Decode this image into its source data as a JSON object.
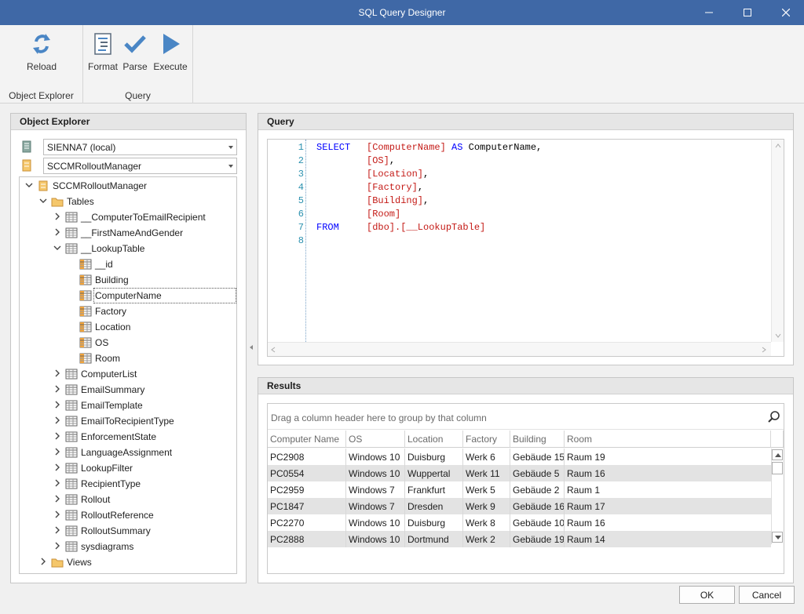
{
  "window": {
    "title": "SQL Query Designer"
  },
  "ribbon": {
    "groups": [
      {
        "label": "Object Explorer",
        "buttons": [
          {
            "label": "Reload",
            "icon": "reload-icon"
          }
        ]
      },
      {
        "label": "Query",
        "buttons": [
          {
            "label": "Format",
            "icon": "format-icon"
          },
          {
            "label": "Parse",
            "icon": "checkmark-icon"
          },
          {
            "label": "Execute",
            "icon": "play-icon"
          }
        ]
      }
    ]
  },
  "object_explorer": {
    "title": "Object Explorer",
    "server": "SIENNA7 (local)",
    "database": "SCCMRolloutManager",
    "tree": {
      "root": "SCCMRolloutManager",
      "tables_label": "Tables",
      "tables_before": [
        "__ComputerToEmailRecipient",
        "__FirstNameAndGender"
      ],
      "expanded_table": "__LookupTable",
      "columns": [
        "__id",
        "Building",
        "ComputerName",
        "Factory",
        "Location",
        "OS",
        "Room"
      ],
      "selected_column": "ComputerName",
      "tables_after": [
        "ComputerList",
        "EmailSummary",
        "EmailTemplate",
        "EmailToRecipientType",
        "EnforcementState",
        "LanguageAssignment",
        "LookupFilter",
        "RecipientType",
        "Rollout",
        "RolloutReference",
        "RolloutSummary",
        "sysdiagrams"
      ],
      "views_label": "Views"
    }
  },
  "query": {
    "title": "Query",
    "lines": [
      {
        "n": "1",
        "kw": "SELECT",
        "id": "[ComputerName]",
        "rest": " AS ComputerName,",
        "rest_kw": "AS",
        "rest_tail": " ComputerName,"
      },
      {
        "n": "2",
        "kw": "",
        "id": "[OS]",
        "tail": ","
      },
      {
        "n": "3",
        "kw": "",
        "id": "[Location]",
        "tail": ","
      },
      {
        "n": "4",
        "kw": "",
        "id": "[Factory]",
        "tail": ","
      },
      {
        "n": "5",
        "kw": "",
        "id": "[Building]",
        "tail": ","
      },
      {
        "n": "6",
        "kw": "",
        "id": "[Room]",
        "tail": ""
      },
      {
        "n": "7",
        "kw": "FROM",
        "id": "[dbo].[__LookupTable]",
        "tail": ""
      },
      {
        "n": "8",
        "kw": "",
        "id": "",
        "tail": ""
      }
    ]
  },
  "results": {
    "title": "Results",
    "group_hint": "Drag a column header here to group by that column",
    "columns": [
      "Computer Name",
      "OS",
      "Location",
      "Factory",
      "Building",
      "Room"
    ],
    "rows": [
      [
        "PC2908",
        "Windows 10",
        "Duisburg",
        "Werk 6",
        "Gebäude 15",
        "Raum 19"
      ],
      [
        "PC0554",
        "Windows 10",
        "Wuppertal",
        "Werk 11",
        "Gebäude 5",
        "Raum 16"
      ],
      [
        "PC2959",
        "Windows 7",
        "Frankfurt",
        "Werk 5",
        "Gebäude 2",
        "Raum 1"
      ],
      [
        "PC1847",
        "Windows 7",
        "Dresden",
        "Werk 9",
        "Gebäude 16",
        "Raum 17"
      ],
      [
        "PC2270",
        "Windows 10",
        "Duisburg",
        "Werk 8",
        "Gebäude 10",
        "Raum 16"
      ],
      [
        "PC2888",
        "Windows 10",
        "Dortmund",
        "Werk 2",
        "Gebäude 19",
        "Raum 14"
      ]
    ]
  },
  "footer": {
    "ok": "OK",
    "cancel": "Cancel"
  },
  "colors": {
    "titlebar": "#3f68a6",
    "keyword": "#0000ff",
    "identifier": "#c41a16",
    "line_number": "#2b91af",
    "ribbon_icon": "#4a86c5"
  }
}
